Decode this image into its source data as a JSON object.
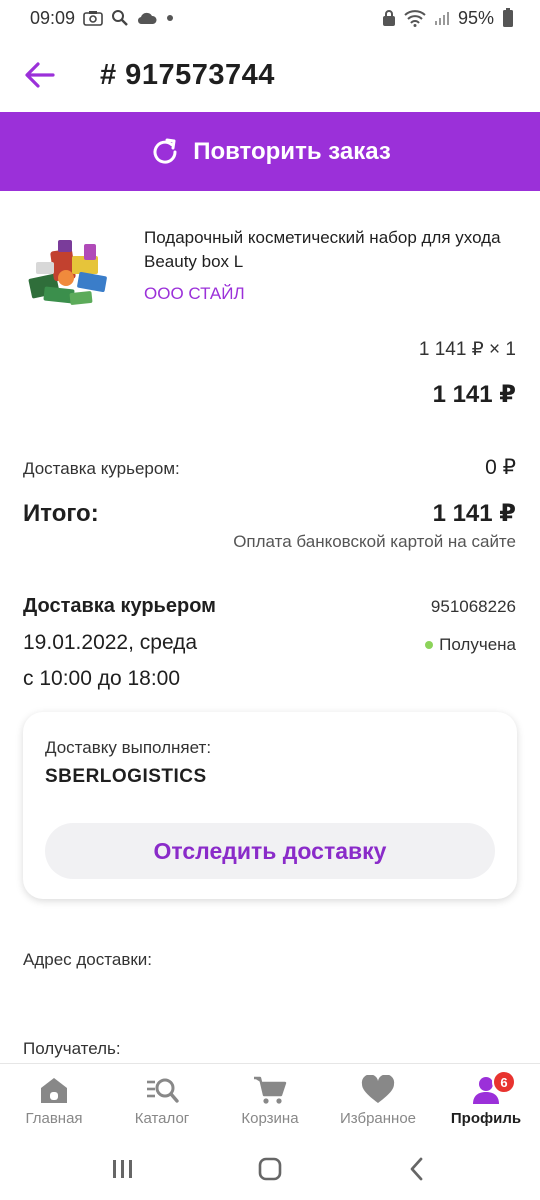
{
  "status_bar": {
    "time": "09:09",
    "battery": "95%"
  },
  "header": {
    "order_title": "# 917573744"
  },
  "repeat_button": {
    "label": "Повторить заказ"
  },
  "product": {
    "name": "Подарочный косметический набор для ухода Beauty box L",
    "seller": "ООО СТАЙЛ",
    "price_unit": "1 141 ₽ × 1",
    "price_total": "1 141 ₽"
  },
  "summary": {
    "delivery_label": "Доставка курьером:",
    "delivery_value": "0 ₽",
    "total_label": "Итого:",
    "total_value": "1 141 ₽",
    "payment_note": "Оплата банковской картой на сайте"
  },
  "delivery": {
    "title": "Доставка курьером",
    "number": "951068226",
    "date": "19.01.2022, среда",
    "status": "Получена",
    "time_window": "с 10:00 до 18:00"
  },
  "carrier": {
    "label": "Доставку выполняет:",
    "name": "SBERLOGISTICS",
    "track_button": "Отследить доставку"
  },
  "address": {
    "label": "Адрес доставки:"
  },
  "recipient": {
    "label": "Получатель:"
  },
  "bottom_nav": {
    "items": [
      {
        "label": "Главная",
        "icon": "home-icon"
      },
      {
        "label": "Каталог",
        "icon": "catalog-search-icon"
      },
      {
        "label": "Корзина",
        "icon": "cart-icon"
      },
      {
        "label": "Избранное",
        "icon": "heart-icon"
      },
      {
        "label": "Профиль",
        "icon": "profile-icon"
      }
    ],
    "active_index": 4,
    "profile_badge": "6"
  },
  "colors": {
    "accent": "#9b30d9",
    "status_green": "#8cd35a",
    "badge_red": "#e8332f"
  }
}
